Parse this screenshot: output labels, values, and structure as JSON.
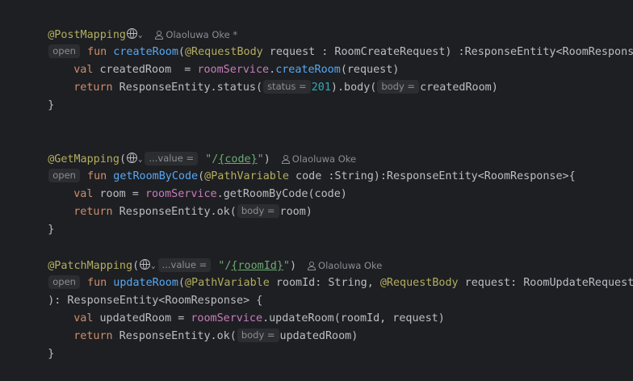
{
  "editor": {
    "colors": {
      "background": "#1e1f22",
      "annotation": "#b3ae60",
      "keyword": "#cf8e6d",
      "function": "#56a8f5",
      "service": "#c77dbb",
      "number": "#2aacb8",
      "string": "#6aab73",
      "plain": "#bcbec4",
      "hint": "#8b8d93"
    },
    "author_current": "Olaoluwa Oke *",
    "author": "Olaoluwa Oke",
    "post": {
      "annotation": "@PostMapping",
      "open_hint": "open",
      "fun_kw": "fun",
      "name": "createRoom",
      "paren_open": "(",
      "param_ann": "@RequestBody",
      "params_rest": " request : RoomCreateRequest) :ResponseEntity<RoomResponse>{",
      "val_kw": "val",
      "var_decl": " createdRoom  = ",
      "service": "roomService",
      "dot": ".",
      "call": "createRoom",
      "call_args": "(request)",
      "return_kw": "return",
      "resp": " ResponseEntity.",
      "status_fn": "status",
      "paren": "(",
      "status_hint": "status =",
      "status_value": "201",
      "body_pre": ").",
      "body_fn": "body",
      "body_hint": "body =",
      "body_rest": "createdRoom)",
      "close": "}"
    },
    "get": {
      "annotation": "@GetMapping",
      "paren_open": "(",
      "value_hint": "...value =",
      "quote_open": "\"/",
      "path_var": "{code}",
      "quote_close": "\"",
      "paren_close": ")",
      "open_hint": "open",
      "fun_kw": "fun",
      "name": "getRoomByCode",
      "param_ann": "@PathVariable",
      "params_rest": " code :String):ResponseEntity<RoomResponse>{",
      "val_kw": "val",
      "var_decl": " room = ",
      "service": "roomService",
      "dot": ".",
      "call": "getRoomByCode",
      "call_args": "(code)",
      "return_kw": "return",
      "resp": " ResponseEntity.",
      "ok_fn": "ok",
      "paren": "(",
      "body_hint": "body =",
      "body_rest": "room)",
      "close": "}"
    },
    "patch": {
      "annotation": "@PatchMapping",
      "paren_open": "(",
      "value_hint": "...value =",
      "quote_open": "\"/",
      "path_var": "{roomId}",
      "quote_close": "\"",
      "paren_close": ")",
      "open_hint": "open",
      "fun_kw": "fun",
      "name": "updateRoom",
      "param_ann": "@PathVariable",
      "params_mid": " roomId: String, ",
      "param_ann2": "@RequestBody",
      "params_rest": " request: RoomUpdateRequest",
      "return_type": "): ResponseEntity<RoomResponse> {",
      "val_kw": "val",
      "var_decl": " updatedRoom = ",
      "service": "roomService",
      "dot": ".",
      "call": "updateRoom",
      "call_args": "(roomId, request)",
      "return_kw": "return",
      "resp": " ResponseEntity.",
      "ok_fn": "ok",
      "paren": "(",
      "body_hint": "body =",
      "body_rest": "updatedRoom)",
      "close": "}"
    }
  }
}
